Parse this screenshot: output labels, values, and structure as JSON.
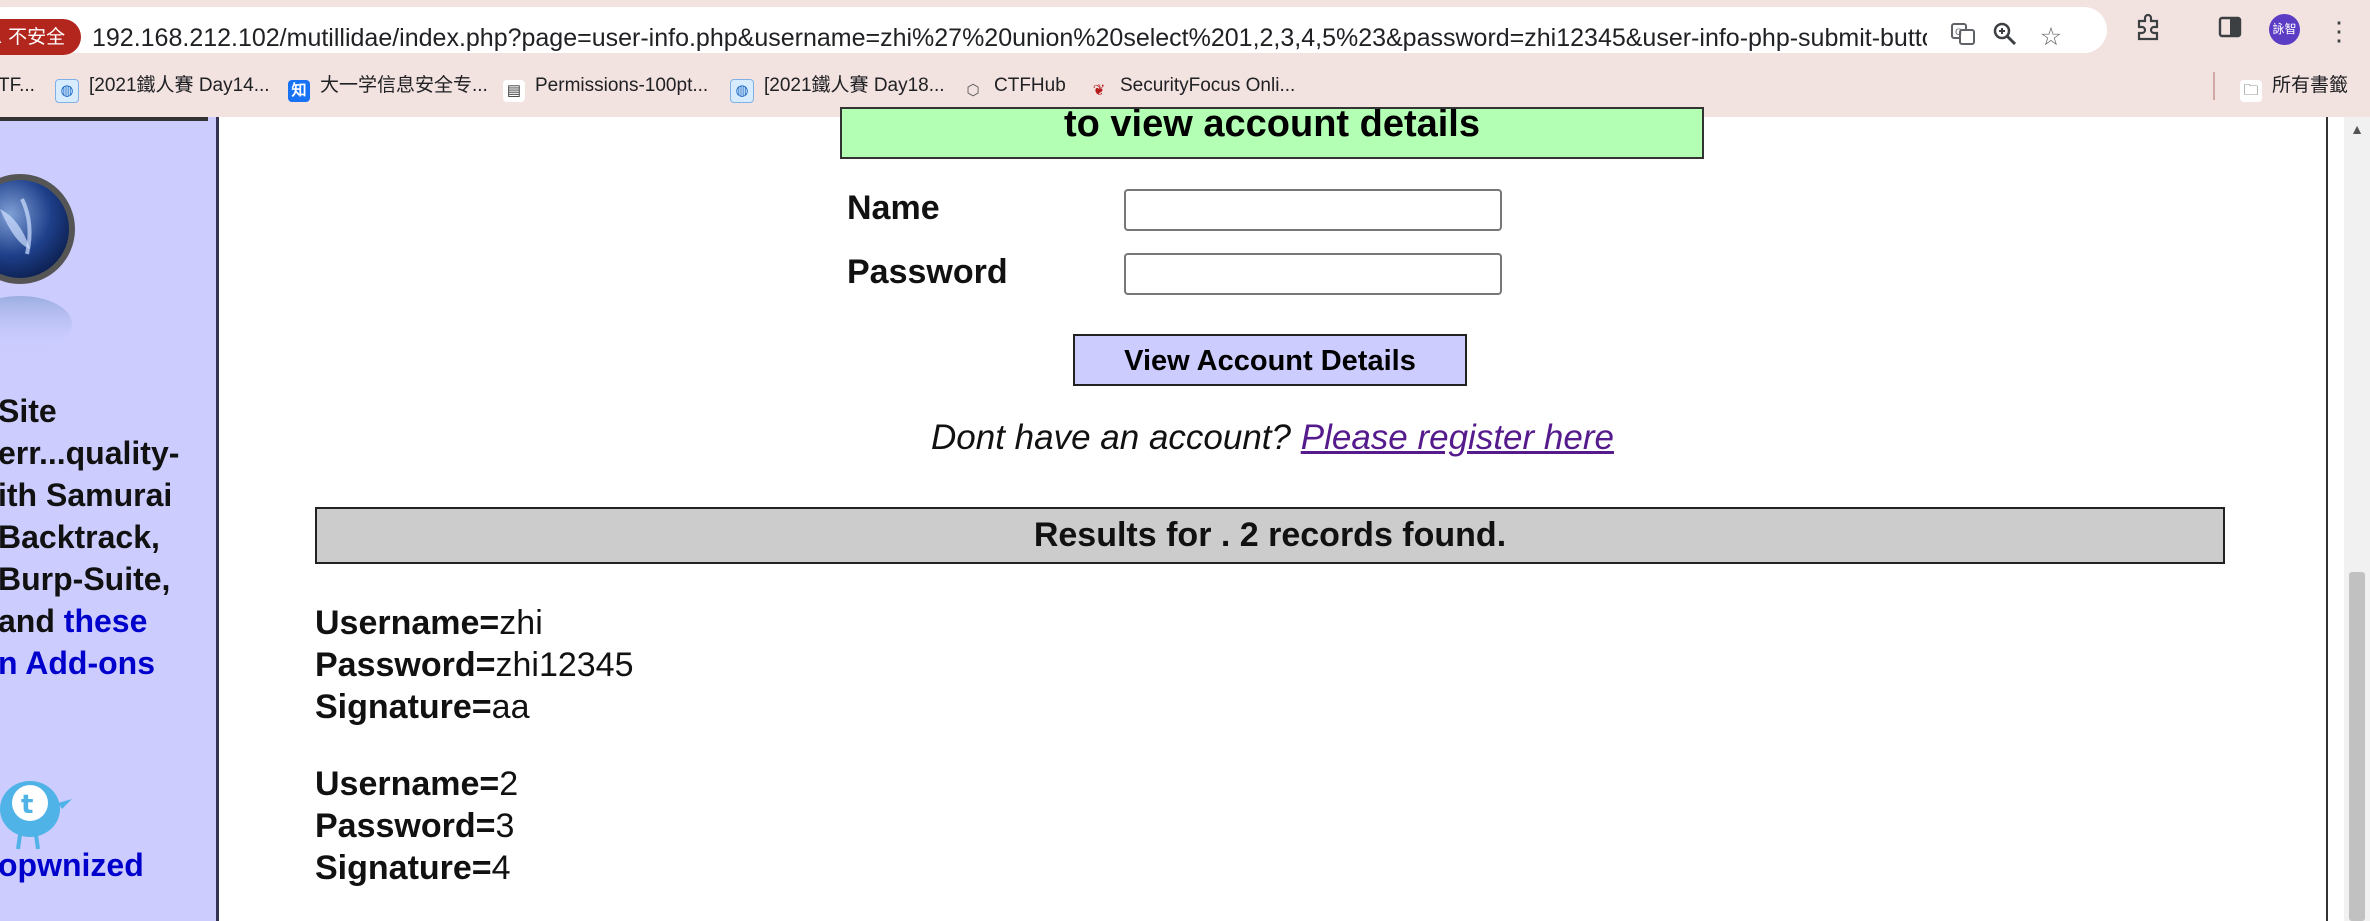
{
  "browser": {
    "security_label": "不安全",
    "url": "192.168.212.102/mutillidae/index.php?page=user-info.php&username=zhi%27%20union%20select%201,2,3,4,5%23&password=zhi12345&user-info-php-submit-button=View+Accou...",
    "icons": [
      "translate-icon",
      "zoom-icon",
      "bookmark-star-icon",
      "extensions-icon",
      "side-panel-icon",
      "menu-icon"
    ],
    "avatar_label": "詠智",
    "bookmarks": [
      {
        "label": "TF...",
        "icon": "none"
      },
      {
        "label": "[2021鐵人賽 Day14...",
        "icon": "globe"
      },
      {
        "label": "大一学信息安全专...",
        "icon": "zhihu"
      },
      {
        "label": "Permissions-100pt...",
        "icon": "document"
      },
      {
        "label": "[2021鐵人賽 Day18...",
        "icon": "globe"
      },
      {
        "label": "CTFHub",
        "icon": "ctfhub"
      },
      {
        "label": "SecurityFocus Onli...",
        "icon": "securityfocus"
      }
    ],
    "all_bookmarks_label": "所有書籤"
  },
  "sidebar": {
    "text_lines": [
      "Site",
      "err...quality-",
      "ith Samurai",
      "Backtrack,",
      "Burp-Suite,"
    ],
    "and_text": " and ",
    "these_link": "these",
    "addons_link": "n Add-ons",
    "pwn_link": "opwnized",
    "icons": [
      "owasp-logo-icon",
      "twitter-bird-icon"
    ]
  },
  "form": {
    "heading": "to view account details",
    "name_label": "Name",
    "password_label": "Password",
    "name_value": "",
    "password_value": "",
    "submit_label": "View Account Details",
    "register_prompt": "Dont have an account?",
    "register_link": "Please register here"
  },
  "results": {
    "header": "Results for . 2 records found.",
    "records": [
      {
        "username": "zhi",
        "password": "zhi12345",
        "signature": "aa"
      },
      {
        "username": "2",
        "password": "3",
        "signature": "4"
      }
    ],
    "labels": {
      "username": "Username=",
      "password": "Password=",
      "signature": "Signature="
    }
  },
  "colors": {
    "chrome_bg": "#f2e2e0",
    "sidebar_bg": "#ccccff",
    "heading_bg": "#b3ffb3",
    "button_bg": "#ccccff",
    "results_bar_bg": "#cccccc",
    "link": "#0000cc",
    "visited_link": "#551a8b",
    "security_chip": "#b3261e"
  }
}
